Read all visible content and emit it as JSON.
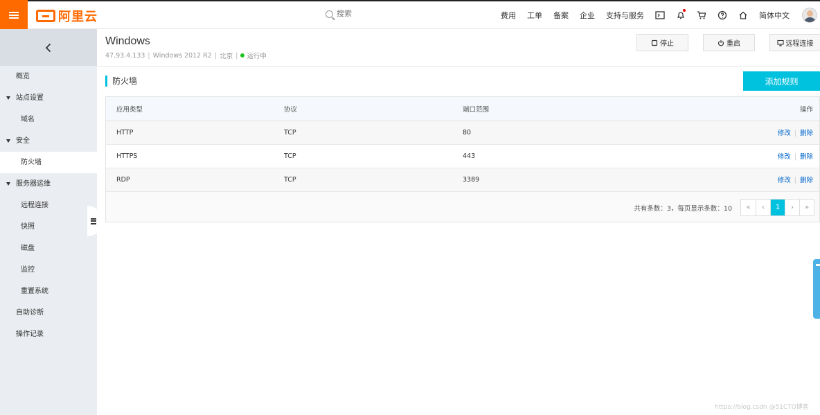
{
  "topbar": {
    "logo_text": "阿里云",
    "search_placeholder": "搜索",
    "nav_items": [
      "费用",
      "工单",
      "备案",
      "企业",
      "支持与服务"
    ],
    "language": "简体中文"
  },
  "sidebar": {
    "items": [
      {
        "label": "概览",
        "level": "top",
        "caret": false,
        "active": false
      },
      {
        "label": "站点设置",
        "level": "top",
        "caret": true,
        "active": false
      },
      {
        "label": "域名",
        "level": "sub",
        "caret": false,
        "active": false
      },
      {
        "label": "安全",
        "level": "top",
        "caret": true,
        "active": false
      },
      {
        "label": "防火墙",
        "level": "sub",
        "caret": false,
        "active": true
      },
      {
        "label": "服务器运维",
        "level": "top",
        "caret": true,
        "active": false
      },
      {
        "label": "远程连接",
        "level": "sub",
        "caret": false,
        "active": false
      },
      {
        "label": "快照",
        "level": "sub",
        "caret": false,
        "active": false
      },
      {
        "label": "磁盘",
        "level": "sub",
        "caret": false,
        "active": false
      },
      {
        "label": "监控",
        "level": "sub",
        "caret": false,
        "active": false
      },
      {
        "label": "重置系统",
        "level": "sub",
        "caret": false,
        "active": false
      },
      {
        "label": "自助诊断",
        "level": "top",
        "caret": false,
        "active": false
      },
      {
        "label": "操作记录",
        "level": "top",
        "caret": false,
        "active": false
      }
    ]
  },
  "instance": {
    "title": "Windows",
    "ip": "47.93.4.133",
    "os": "Windows 2012 R2",
    "region": "北京",
    "status": "运行中"
  },
  "header_buttons": {
    "stop": "停止",
    "restart": "重启",
    "remote": "远程连接"
  },
  "firewall": {
    "section_title": "防火墙",
    "add_button": "添加规则",
    "columns": [
      "应用类型",
      "协议",
      "端口范围",
      "操作"
    ],
    "rows": [
      {
        "app": "HTTP",
        "protocol": "TCP",
        "port": "80"
      },
      {
        "app": "HTTPS",
        "protocol": "TCP",
        "port": "443"
      },
      {
        "app": "RDP",
        "protocol": "TCP",
        "port": "3389"
      }
    ],
    "edit_label": "修改",
    "delete_label": "删除",
    "pager_info": "共有条数：3，每页显示条数：10",
    "pager": {
      "first": "«",
      "prev": "‹",
      "current": "1",
      "next": "›",
      "last": "»"
    }
  },
  "watermark": "https://blog.csdn @51CTO博客",
  "colors": {
    "brand": "#ff6a00",
    "accent": "#00c1de",
    "link": "#0066cc",
    "status_running": "#1dc11d"
  }
}
